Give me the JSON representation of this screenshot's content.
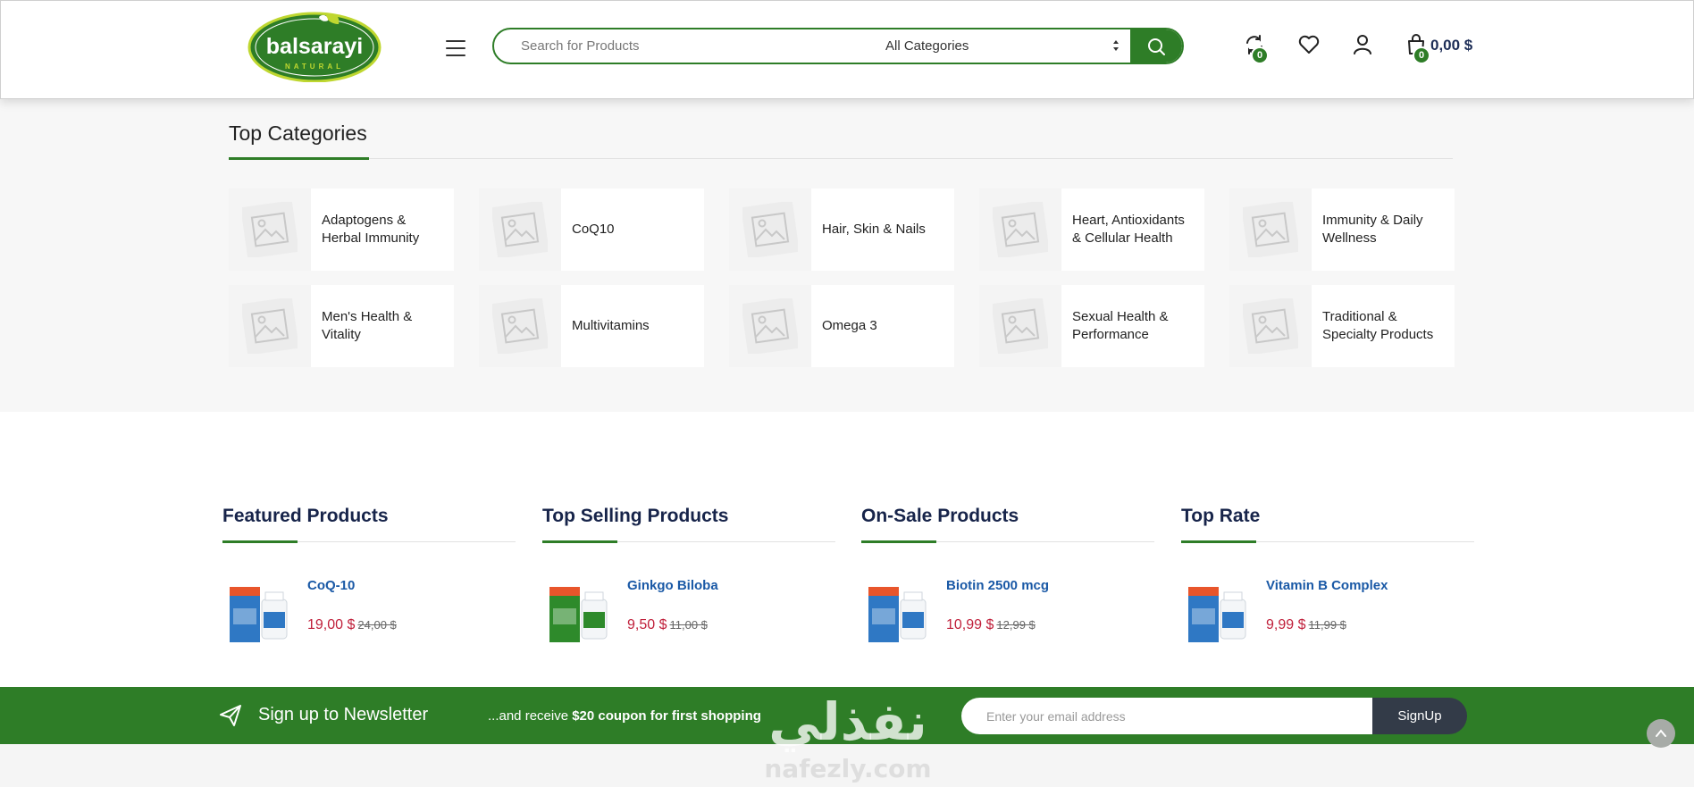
{
  "header": {
    "logo_text": "balsarayi",
    "logo_sub": "NATURAL",
    "search_placeholder": "Search for Products",
    "category_select": "All Categories",
    "compare_count": "0",
    "cart_count": "0",
    "cart_total": "0,00 $"
  },
  "top_categories": {
    "title": "Top Categories",
    "items": [
      {
        "name": "Adaptogens & Herbal Immunity"
      },
      {
        "name": "CoQ10"
      },
      {
        "name": "Hair, Skin & Nails"
      },
      {
        "name": "Heart, Antioxidants & Cellular Health"
      },
      {
        "name": "Immunity & Daily Wellness"
      },
      {
        "name": "Men's Health & Vitality"
      },
      {
        "name": "Multivitamins"
      },
      {
        "name": "Omega 3"
      },
      {
        "name": "Sexual Health & Performance"
      },
      {
        "name": "Traditional & Specialty Products"
      }
    ]
  },
  "product_columns": [
    {
      "title": "Featured Products",
      "product": {
        "name": "CoQ-10",
        "price": "19,00 $",
        "old_price": "24,00 $",
        "box_color": "#2f78c4"
      }
    },
    {
      "title": "Top Selling Products",
      "product": {
        "name": "Ginkgo Biloba",
        "price": "9,50 $",
        "old_price": "11,00 $",
        "box_color": "#2e8a2b"
      }
    },
    {
      "title": "On-Sale Products",
      "product": {
        "name": "Biotin 2500 mcg",
        "price": "10,99 $",
        "old_price": "12,99 $",
        "box_color": "#2f78c4"
      }
    },
    {
      "title": "Top Rate",
      "product": {
        "name": "Vitamin B Complex",
        "price": "9,99 $",
        "old_price": "11,99 $",
        "box_color": "#2f78c4"
      }
    }
  ],
  "newsletter": {
    "title": "Sign up to Newsletter",
    "sub_prefix": "...and receive ",
    "sub_bold": "$20 coupon for first shopping",
    "email_placeholder": "Enter your email address",
    "button": "SignUp"
  },
  "watermark": {
    "arabic": "نفذلي",
    "latin": "nafezly.com"
  },
  "colors": {
    "brand_green": "#2e7d27",
    "price_red": "#c0203b",
    "link_blue": "#1a59a6",
    "title_navy": "#17244a"
  }
}
